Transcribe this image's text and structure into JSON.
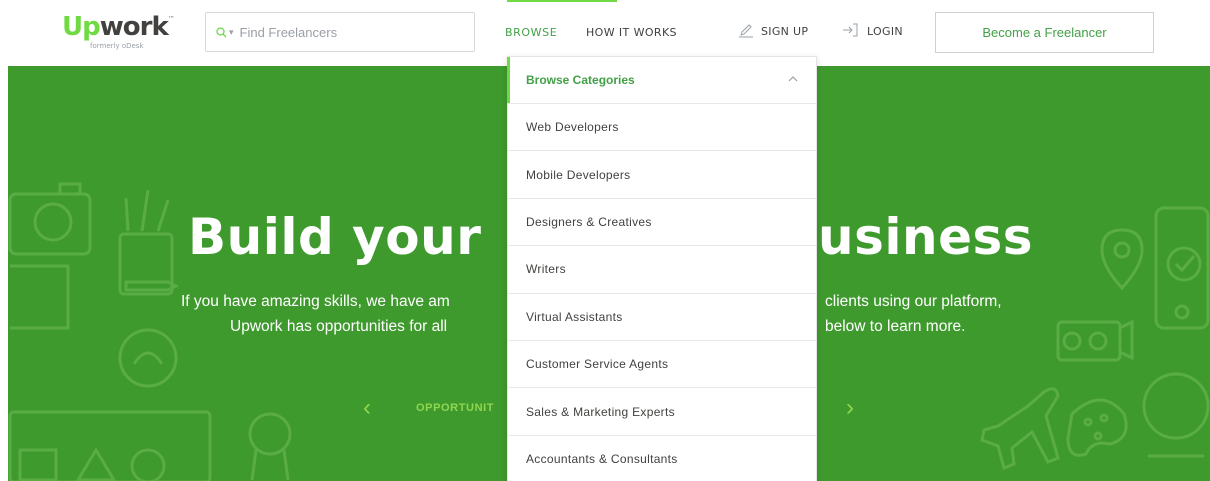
{
  "logo": {
    "part_green": "Up",
    "part_dark": "work",
    "tagline": "formerly oDesk"
  },
  "search": {
    "placeholder": "Find Freelancers",
    "icon": "search-icon"
  },
  "nav": {
    "browse": "BROWSE",
    "how_it_works": "HOW IT WORKS",
    "sign_up": "SIGN UP",
    "login": "LOGIN",
    "become_freelancer": "Become a Freelancer"
  },
  "hero": {
    "title_left": "Build your",
    "title_right": "usiness",
    "line1_left": "If you have amazing skills, we have am",
    "line1_right": "clients using our platform,",
    "line2_left": "Upwork has opportunities for all",
    "line2_right": "below to learn more.",
    "opportunities_label": "OPPORTUNIT"
  },
  "dropdown": {
    "header": "Browse Categories",
    "items": [
      "Web Developers",
      "Mobile Developers",
      "Designers & Creatives",
      "Writers",
      "Virtual Assistants",
      "Customer Service Agents",
      "Sales & Marketing Experts",
      "Accountants & Consultants"
    ]
  },
  "colors": {
    "brand_green": "#6fda44",
    "hero_green": "#3f9a2e",
    "text_dark": "#43413f",
    "link_green": "#43a047"
  }
}
